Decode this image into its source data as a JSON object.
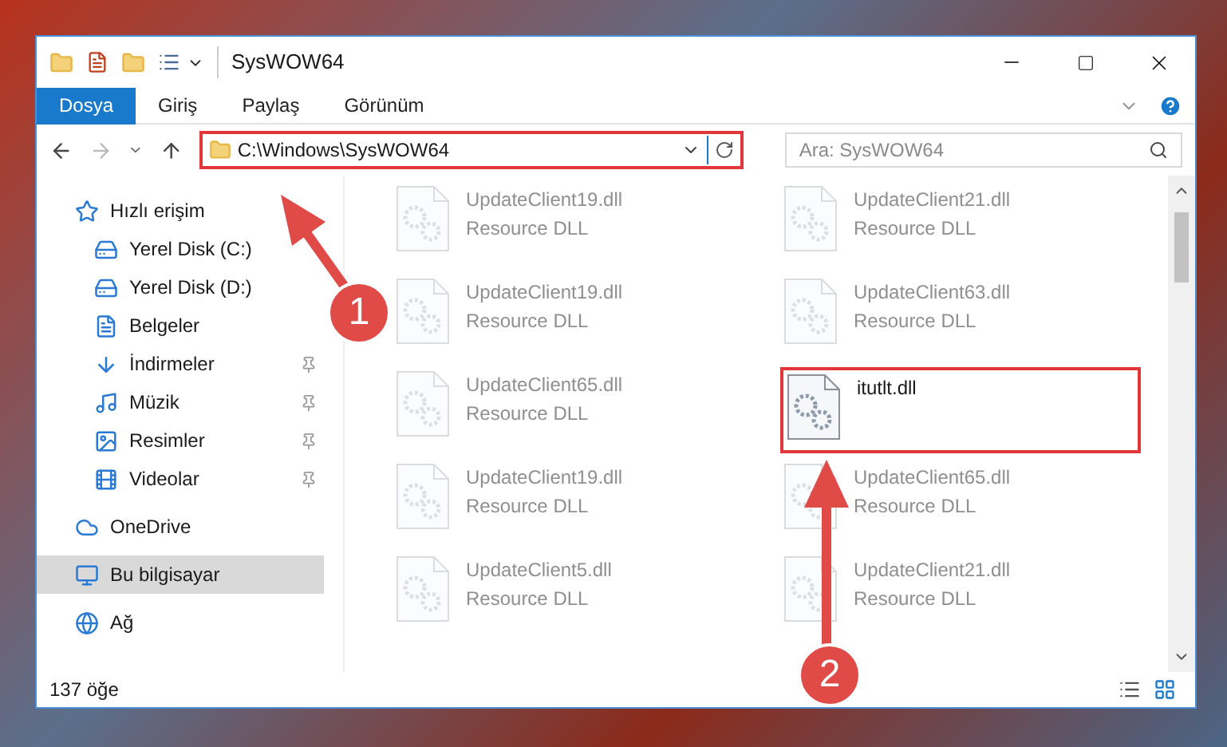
{
  "window": {
    "title": "SysWOW64"
  },
  "ribbon_tabs": [
    {
      "label": "Dosya",
      "selected": true
    },
    {
      "label": "Giriş",
      "selected": false
    },
    {
      "label": "Paylaş",
      "selected": false
    },
    {
      "label": "Görünüm",
      "selected": false
    }
  ],
  "address_bar": {
    "path": "C:\\Windows\\SysWOW64",
    "highlighted": true
  },
  "search": {
    "placeholder": "Ara: SysWOW64"
  },
  "sidebar": {
    "items": [
      {
        "label": "Hızlı erişim",
        "pinned": false,
        "selected": false,
        "children": [
          {
            "label": "Yerel Disk (C:)",
            "pinned": false,
            "selected": false
          },
          {
            "label": "Yerel Disk (D:)",
            "pinned": false,
            "selected": false
          },
          {
            "label": "Belgeler",
            "pinned": false,
            "selected": false
          },
          {
            "label": "İndirmeler",
            "pinned": true,
            "selected": false
          },
          {
            "label": "Müzik",
            "pinned": true,
            "selected": false
          },
          {
            "label": "Resimler",
            "pinned": true,
            "selected": false
          },
          {
            "label": "Videolar",
            "pinned": true,
            "selected": false
          }
        ]
      },
      {
        "label": "OneDrive",
        "pinned": false,
        "selected": false
      },
      {
        "label": "Bu bilgisayar",
        "pinned": false,
        "selected": true
      },
      {
        "label": "Ağ",
        "pinned": false,
        "selected": false
      }
    ]
  },
  "files": [
    {
      "name": "UpdateClient19.dll",
      "type": "Resource DLL",
      "highlighted": false
    },
    {
      "name": "UpdateClient21.dll",
      "type": "Resource DLL",
      "highlighted": false
    },
    {
      "name": "UpdateClient19.dll",
      "type": "Resource DLL",
      "highlighted": false
    },
    {
      "name": "UpdateClient63.dll",
      "type": "Resource DLL",
      "highlighted": false
    },
    {
      "name": "UpdateClient65.dll",
      "type": "Resource DLL",
      "highlighted": false
    },
    {
      "name": "itutlt.dll",
      "highlighted": true
    },
    {
      "name": "UpdateClient19.dll",
      "type": "Resource DLL",
      "highlighted": false
    },
    {
      "name": "UpdateClient65.dll",
      "type": "Resource DLL",
      "highlighted": false
    },
    {
      "name": "UpdateClient5.dll",
      "type": "Resource DLL",
      "highlighted": false
    },
    {
      "name": "UpdateClient21.dll",
      "type": "Resource DLL",
      "highlighted": false
    }
  ],
  "status_bar": {
    "item_count": "137 öğe"
  },
  "annotations": [
    {
      "number": "1"
    },
    {
      "number": "2"
    }
  ]
}
